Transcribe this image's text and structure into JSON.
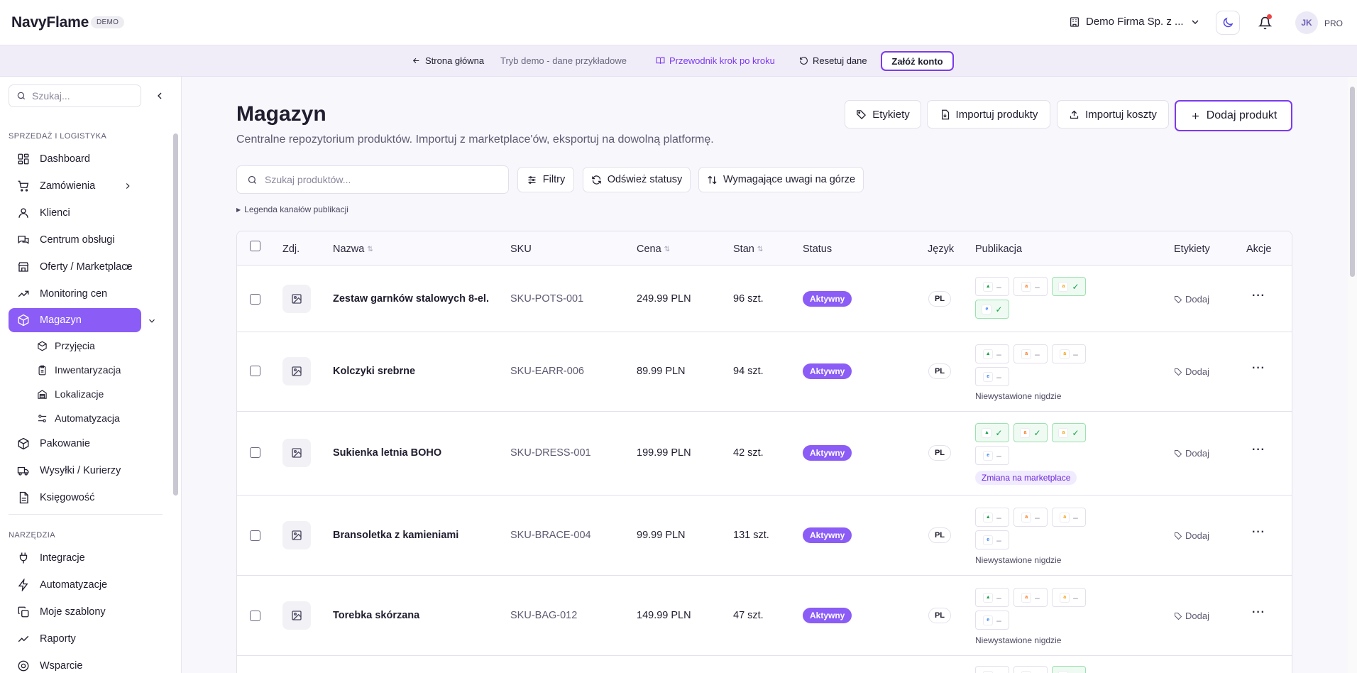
{
  "app": {
    "brand": "NavyFlame",
    "badge": "DEMO"
  },
  "header": {
    "company": "Demo Firma Sp. z ...",
    "avatar": "JK",
    "plan": "PRO"
  },
  "demobar": {
    "home": "Strona główna",
    "mode": "Tryb demo - dane przykładowe",
    "guide": "Przewodnik krok po kroku",
    "reset": "Resetuj dane",
    "signup": "Załóż konto"
  },
  "sidebar": {
    "search_placeholder": "Szukaj...",
    "section1": "SPRZEDAŻ I LOGISTYKA",
    "section2": "NARZĘDZIA",
    "items": [
      {
        "label": "Dashboard"
      },
      {
        "label": "Zamówienia"
      },
      {
        "label": "Klienci"
      },
      {
        "label": "Centrum obsługi"
      },
      {
        "label": "Oferty / Marketplace"
      },
      {
        "label": "Monitoring cen"
      },
      {
        "label": "Magazyn"
      },
      {
        "label": "Pakowanie"
      },
      {
        "label": "Wysyłki / Kurierzy"
      },
      {
        "label": "Księgowość"
      },
      {
        "label": "Integracje"
      },
      {
        "label": "Automatyzacje"
      },
      {
        "label": "Moje szablony"
      },
      {
        "label": "Raporty"
      },
      {
        "label": "Wsparcie"
      }
    ],
    "subitems": [
      {
        "label": "Przyjęcia"
      },
      {
        "label": "Inwentaryzacja"
      },
      {
        "label": "Lokalizacje"
      },
      {
        "label": "Automatyzacja"
      }
    ]
  },
  "page": {
    "title": "Magazyn",
    "subtitle": "Centralne repozytorium produktów. Importuj z marketplace'ów, eksportuj na dowolną platformę.",
    "buttons": {
      "labels": "Etykiety",
      "import_products": "Importuj produkty",
      "import_costs": "Importuj koszty",
      "add_product": "Dodaj produkt"
    },
    "search_placeholder": "Szukaj produktów...",
    "filters": "Filtry",
    "refresh": "Odśwież statusy",
    "attention": "Wymagające uwagi na górze",
    "legend": "Legenda kanałów publikacji"
  },
  "table": {
    "headers": {
      "photo": "Zdj.",
      "name": "Nazwa",
      "sku": "SKU",
      "price": "Cena",
      "stock": "Stan",
      "status": "Status",
      "lang": "Język",
      "pub": "Publikacja",
      "tags": "Etykiety",
      "actions": "Akcje"
    },
    "tag_add": "Dodaj",
    "rows": [
      {
        "name": "Zestaw garnków stalowych 8-el.",
        "sku": "SKU-POTS-001",
        "price": "249.99 PLN",
        "stock": "96 szt.",
        "status": "Aktywny",
        "lang": "PL",
        "note": ""
      },
      {
        "name": "Kolczyki srebrne",
        "sku": "SKU-EARR-006",
        "price": "89.99 PLN",
        "stock": "94 szt.",
        "status": "Aktywny",
        "lang": "PL",
        "note": "Niewystawione nigdzie"
      },
      {
        "name": "Sukienka letnia BOHO",
        "sku": "SKU-DRESS-001",
        "price": "199.99 PLN",
        "stock": "42 szt.",
        "status": "Aktywny",
        "lang": "PL",
        "note": "Zmiana na marketplace"
      },
      {
        "name": "Bransoletka z kamieniami",
        "sku": "SKU-BRACE-004",
        "price": "99.99 PLN",
        "stock": "131 szt.",
        "status": "Aktywny",
        "lang": "PL",
        "note": "Niewystawione nigdzie"
      },
      {
        "name": "Torebka skórzana",
        "sku": "SKU-BAG-012",
        "price": "149.99 PLN",
        "stock": "47 szt.",
        "status": "Aktywny",
        "lang": "PL",
        "note": "Niewystawione nigdzie"
      }
    ]
  },
  "colors": {
    "accent": "#8b5cf6",
    "accent_border": "#7c3aed",
    "ok": "#16a34a"
  }
}
